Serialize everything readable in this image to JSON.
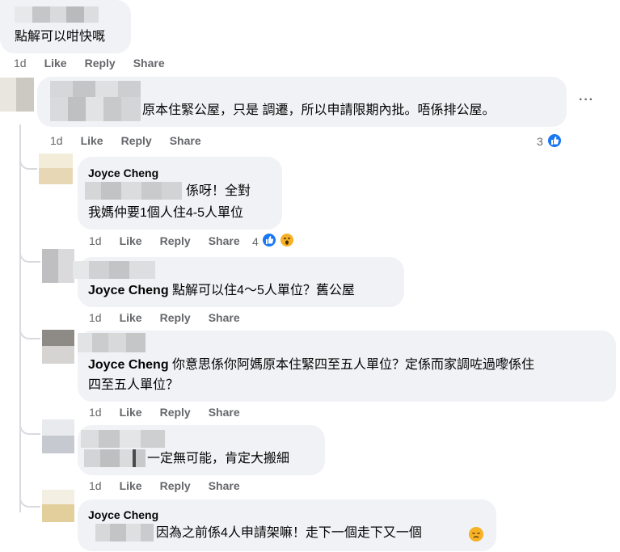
{
  "comments": [
    {
      "text": "點解可以咁快嘅",
      "meta": {
        "time": "1d",
        "like": "Like",
        "reply": "Reply",
        "share": "Share"
      }
    },
    {
      "text": "原本住緊公屋，只是 調遷，所以申請限期內批。唔係排公屋。",
      "meta": {
        "time": "1d",
        "like": "Like",
        "reply": "Reply",
        "share": "Share"
      },
      "reaction_count": "3",
      "more_label": "···"
    },
    {
      "author": "Joyce Cheng",
      "line1": "係呀！全對",
      "line2": "我媽仲要1個人住4-5人單位",
      "meta": {
        "time": "1d",
        "like": "Like",
        "reply": "Reply",
        "share": "Share"
      },
      "reaction_count": "4"
    },
    {
      "tag": "Joyce Cheng",
      "text": "點解可以住4～5人單位？舊公屋",
      "meta": {
        "time": "1d",
        "like": "Like",
        "reply": "Reply",
        "share": "Share"
      }
    },
    {
      "tag": "Joyce Cheng",
      "line1": "你意思係你阿媽原本住緊四至五人單位？定係而家調咗過嚟係住",
      "line2": "四至五人單位？",
      "meta": {
        "time": "1d",
        "like": "Like",
        "reply": "Reply",
        "share": "Share"
      }
    },
    {
      "text": "一定無可能，肯定大搬細",
      "meta": {
        "time": "1d",
        "like": "Like",
        "reply": "Reply",
        "share": "Share"
      }
    },
    {
      "author": "Joyce Cheng",
      "text": "因為之前係4人申請架嘛！走下一個走下又一個"
    }
  ],
  "icons": {
    "like": "like-icon",
    "wow": "wow-icon",
    "sad": "disappointed-emoji-icon",
    "more": "more-options-icon"
  },
  "colors": {
    "bubble": "#f0f2f5",
    "meta": "#65676b",
    "like_blue": "#1877f2"
  }
}
